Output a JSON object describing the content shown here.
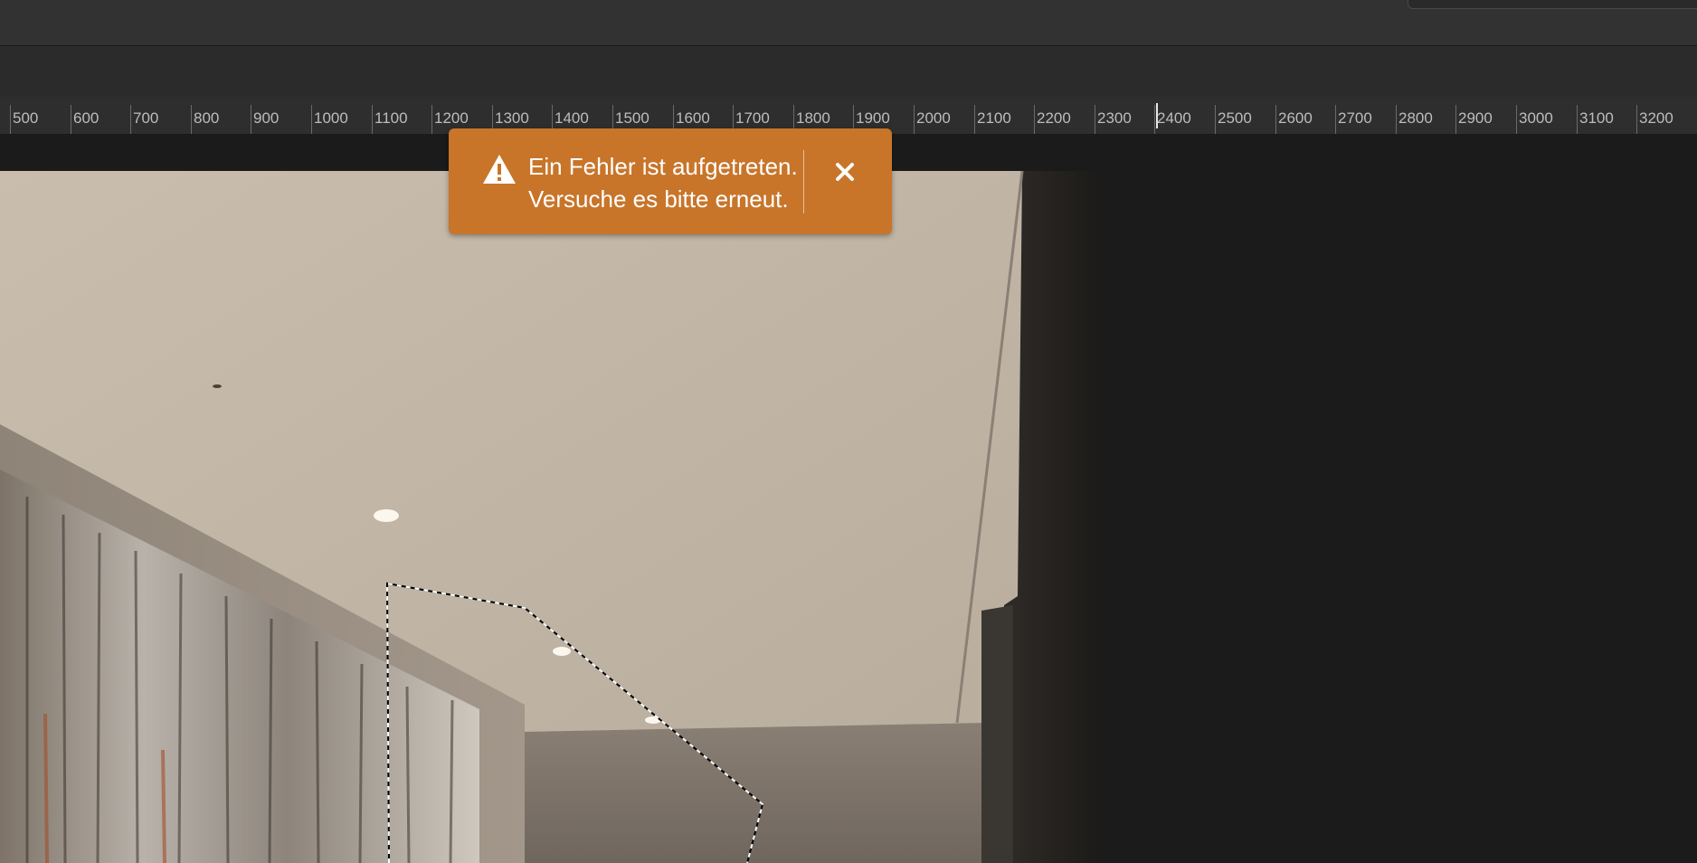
{
  "ruler": {
    "labels": [
      "500",
      "600",
      "700",
      "800",
      "900",
      "1000",
      "1100",
      "1200",
      "1300",
      "1400",
      "1500",
      "1600",
      "1700",
      "1800",
      "1900",
      "2000",
      "2100",
      "2200",
      "2300",
      "2400",
      "2500",
      "2600",
      "2700",
      "2800",
      "2900",
      "3000",
      "3100",
      "3200"
    ]
  },
  "toast": {
    "line1": "Ein Fehler ist aufgetreten.",
    "line2": "Versuche es bitte erneut.",
    "icon": "warning-icon",
    "close_icon": "close-icon",
    "color": "#c8752a"
  }
}
